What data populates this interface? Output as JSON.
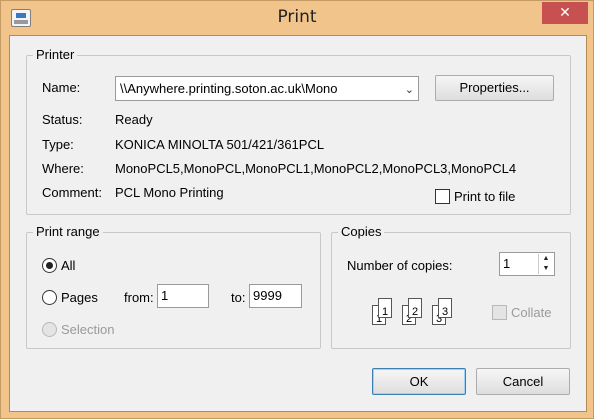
{
  "window": {
    "title": "Print"
  },
  "printer": {
    "group_label": "Printer",
    "name_label": "Name:",
    "name_value": "\\\\Anywhere.printing.soton.ac.uk\\Mono",
    "properties_label": "Properties...",
    "status_label": "Status:",
    "status_value": "Ready",
    "type_label": "Type:",
    "type_value": "KONICA MINOLTA 501/421/361PCL",
    "where_label": "Where:",
    "where_value": "MonoPCL5,MonoPCL,MonoPCL1,MonoPCL2,MonoPCL3,MonoPCL4",
    "comment_label": "Comment:",
    "comment_value": "PCL Mono Printing",
    "print_to_file_label": "Print to file"
  },
  "print_range": {
    "group_label": "Print range",
    "all_label": "All",
    "pages_label": "Pages",
    "from_label": "from:",
    "from_value": "1",
    "to_label": "to:",
    "to_value": "9999",
    "selection_label": "Selection"
  },
  "copies": {
    "group_label": "Copies",
    "number_label": "Number of copies:",
    "number_value": "1",
    "collate_label": "Collate",
    "page_labels": [
      "1",
      "1",
      "2",
      "2",
      "3",
      "3"
    ]
  },
  "buttons": {
    "ok_label": "OK",
    "cancel_label": "Cancel"
  }
}
